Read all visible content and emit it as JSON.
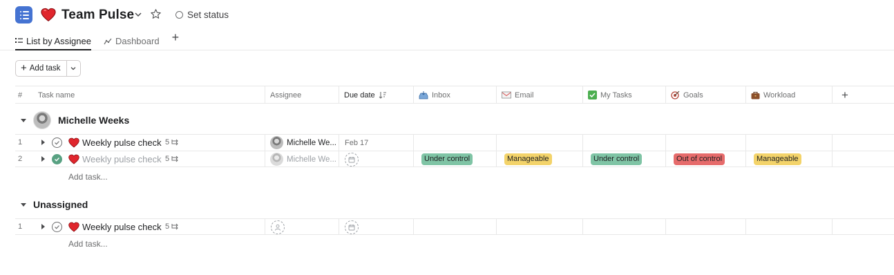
{
  "project": {
    "title": "Team Pulse",
    "set_status": "Set status"
  },
  "tabs": [
    {
      "label": "List by Assignee",
      "active": true
    },
    {
      "label": "Dashboard",
      "active": false
    }
  ],
  "toolbar": {
    "add_task": "Add task"
  },
  "columns": {
    "number": "#",
    "task_name": "Task name",
    "assignee": "Assignee",
    "due_date": "Due date",
    "inbox": "Inbox",
    "email": "Email",
    "my_tasks": "My Tasks",
    "goals": "Goals",
    "workload": "Workload"
  },
  "sections": [
    {
      "name": "Michelle Weeks",
      "add_task": "Add task...",
      "rows": [
        {
          "num": "1",
          "task": "Weekly pulse check",
          "subtasks": "5",
          "assignee": "Michelle We...",
          "due": "Feb 17",
          "completed": false,
          "inbox": "",
          "email": "",
          "my_tasks": "",
          "goals": "",
          "workload": ""
        },
        {
          "num": "2",
          "task": "Weekly pulse check",
          "subtasks": "5",
          "assignee": "Michelle We...",
          "due": "",
          "completed": true,
          "inbox": "Under control",
          "email": "Manageable",
          "my_tasks": "Under control",
          "goals": "Out of control",
          "workload": "Manageable"
        }
      ]
    },
    {
      "name": "Unassigned",
      "add_task": "Add task...",
      "rows": [
        {
          "num": "1",
          "task": "Weekly pulse check",
          "subtasks": "5",
          "assignee": "",
          "due": "",
          "completed": false
        }
      ]
    }
  ],
  "colors": {
    "accent": "#4573d2",
    "done_green": "#58a182",
    "pill_green": "#7fc4a5",
    "pill_yellow": "#f3d36a",
    "pill_red": "#e66b6b"
  }
}
